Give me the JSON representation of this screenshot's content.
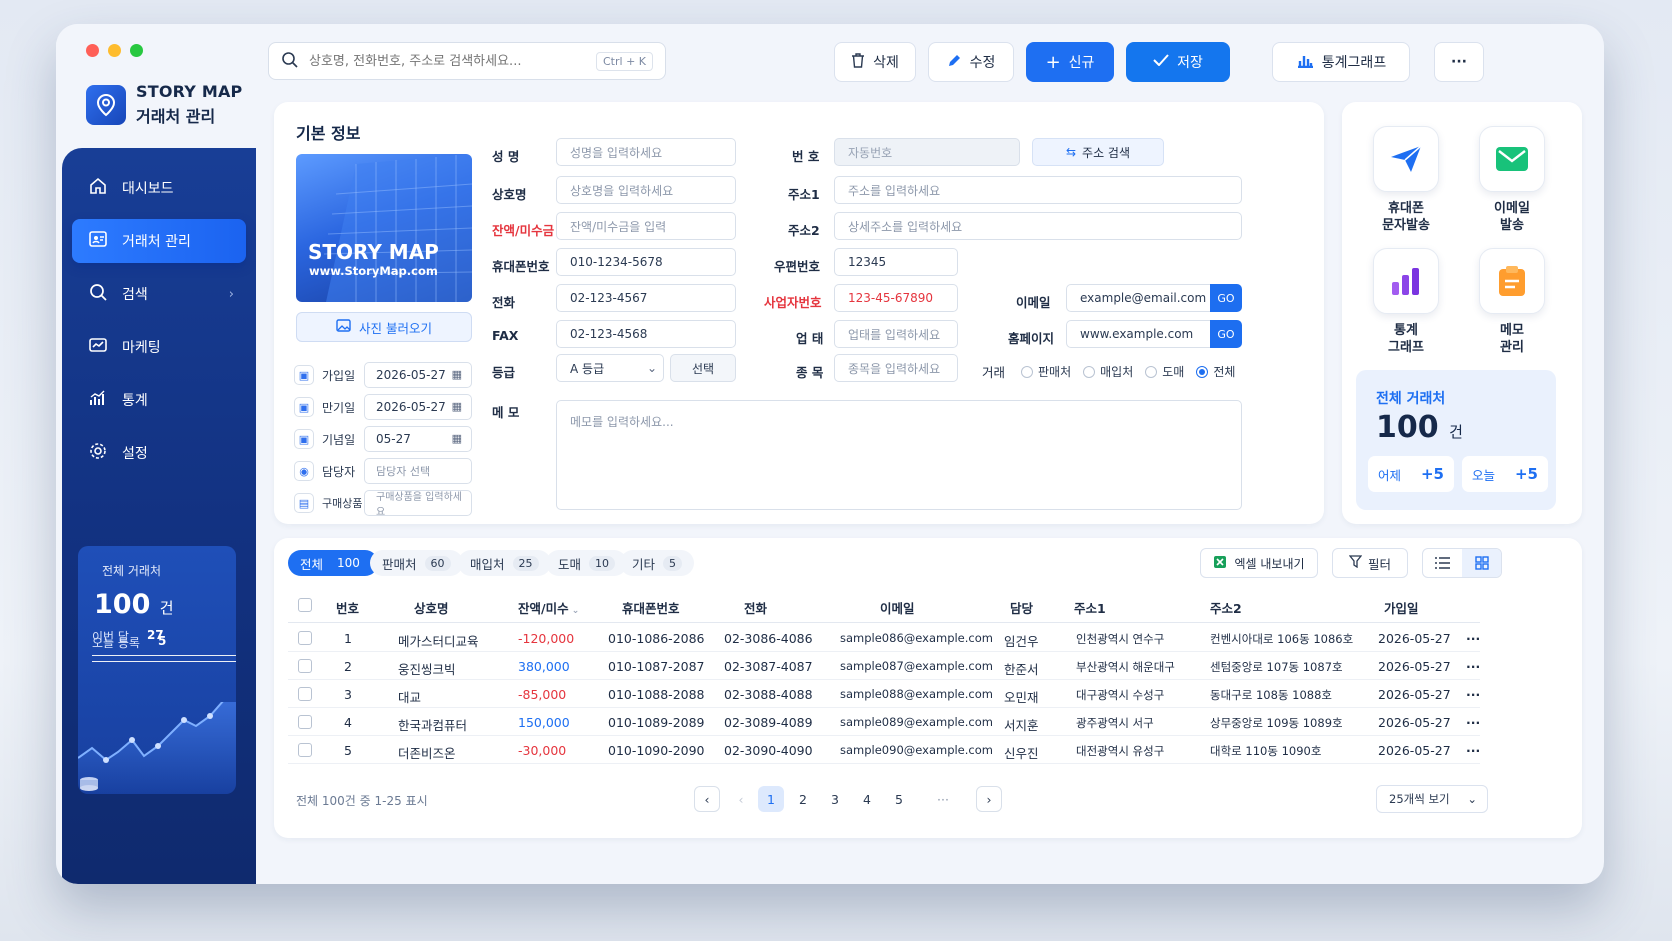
{
  "app": {
    "brand_line1": "STORY MAP",
    "brand_line2": "거래처 관리"
  },
  "nav": [
    {
      "label": "대시보드",
      "icon": "home-icon"
    },
    {
      "label": "거래처 관리",
      "icon": "client-card-icon",
      "active": true
    },
    {
      "label": "검색",
      "icon": "search-icon",
      "has_submenu": true
    },
    {
      "label": "마케팅",
      "icon": "marketing-icon"
    },
    {
      "label": "통계",
      "icon": "stats-icon"
    },
    {
      "label": "설정",
      "icon": "gear-icon"
    }
  ],
  "sidebar_summary": {
    "title": "전체 거래처",
    "count": "100",
    "unit": "건",
    "today_label": "오늘 등록",
    "today_value": "5",
    "month_label": "이번 달",
    "month_value": "27"
  },
  "toolbar": {
    "search_placeholder": "상호명, 전화번호, 주소로 검색하세요...",
    "search_shortcut": "Ctrl + K",
    "delete_label": "삭제",
    "edit_label": "수정",
    "new_label": "신규",
    "save_label": "저장",
    "chart_label": "통계그래프",
    "more_label": "···"
  },
  "form": {
    "section_title": "기본 정보",
    "photo_title": "STORY MAP",
    "photo_url": "www.StoryMap.com",
    "photo_button": "사진 불러오기",
    "dates": [
      {
        "label": "가입일",
        "value": "2026-05-27",
        "calendar": true
      },
      {
        "label": "만기일",
        "value": "2026-05-27",
        "calendar": true
      },
      {
        "label": "기념일",
        "value": "05-27",
        "calendar": true
      },
      {
        "label": "담당자",
        "value": "담당자 선택",
        "placeholder": true
      },
      {
        "label": "구매상품",
        "value": "구매상품을 입력하세요",
        "placeholder": true
      }
    ],
    "name_label": "성  명",
    "name_placeholder": "성명을 입력하세요",
    "company_label": "상호명",
    "company_placeholder": "상호명을 입력하세요",
    "balance_label": "잔액/미수금",
    "balance_placeholder": "잔액/미수금을 입력",
    "mobile_label": "휴대폰번호",
    "mobile_value": "010-1234-5678",
    "phone_label": "전화",
    "phone_value": "02-123-4567",
    "fax_label": "FAX",
    "fax_value": "02-123-4568",
    "grade_label": "등급",
    "grade_value": "A 등급",
    "grade_button": "선택",
    "memo_label": "메 모",
    "memo_placeholder": "메모를 입력하세요...",
    "no_label": "번 호",
    "no_placeholder": "자동번호",
    "addr_search_button": "주소 검색",
    "addr1_label": "주소1",
    "addr1_placeholder": "주소를 입력하세요",
    "addr2_label": "주소2",
    "addr2_placeholder": "상세주소를 입력하세요",
    "zip_label": "우편번호",
    "zip_value": "12345",
    "bizno_label": "사업자번호",
    "bizno_value": "123-45-67890",
    "biztype_label": "업 태",
    "biztype_placeholder": "업태를 입력하세요",
    "item_label": "종 목",
    "item_placeholder": "종목을 입력하세요",
    "email_label": "이메일",
    "email_value": "example@email.com",
    "email_go": "GO",
    "homepage_label": "홈페이지",
    "homepage_value": "www.example.com",
    "homepage_go": "GO",
    "trade_label": "거래",
    "trade_options": [
      {
        "label": "판매처",
        "selected": false
      },
      {
        "label": "매입처",
        "selected": false
      },
      {
        "label": "도매",
        "selected": false
      },
      {
        "label": "전체",
        "selected": true
      }
    ]
  },
  "quick_actions": [
    {
      "line1": "휴대폰",
      "line2": "문자발송",
      "icon": "send-icon"
    },
    {
      "line1": "이메일",
      "line2": "발송",
      "icon": "mail-icon"
    },
    {
      "line1": "통계",
      "line2": "그래프",
      "icon": "bar-chart-icon"
    },
    {
      "line1": "메모",
      "line2": "관리",
      "icon": "memo-icon"
    }
  ],
  "total_card": {
    "title": "전체 거래처",
    "count": "100",
    "unit": "건",
    "yesterday_label": "어제",
    "yesterday_value": "+5",
    "today_label": "오늘",
    "today_value": "+5"
  },
  "filters": {
    "tabs": [
      {
        "label": "전체",
        "count": "100",
        "active": true
      },
      {
        "label": "판매처",
        "count": "60"
      },
      {
        "label": "매입처",
        "count": "25"
      },
      {
        "label": "도매",
        "count": "10"
      },
      {
        "label": "기타",
        "count": "5"
      }
    ],
    "excel_label": "엑셀 내보내기",
    "filter_label": "필터"
  },
  "table": {
    "headers": [
      "번호",
      "상호명",
      "잔액/미수",
      "휴대폰번호",
      "전화",
      "이메일",
      "담당",
      "주소1",
      "주소2",
      "가입일"
    ],
    "rows": [
      {
        "no": "1",
        "name": "메가스터디교육",
        "balance": "-120,000",
        "mobile": "010-1086-2086",
        "phone": "02-3086-4086",
        "email": "sample086@example.com",
        "manager": "임건우",
        "addr1": "인천광역시 연수구",
        "addr2": "컨벤시아대로 106동 1086호",
        "joined": "2026-05-27"
      },
      {
        "no": "2",
        "name": "웅진씽크빅",
        "balance": "380,000",
        "mobile": "010-1087-2087",
        "phone": "02-3087-4087",
        "email": "sample087@example.com",
        "manager": "한준서",
        "addr1": "부산광역시 해운대구",
        "addr2": "센텀중앙로 107동 1087호",
        "joined": "2026-05-27"
      },
      {
        "no": "3",
        "name": "대교",
        "balance": "-85,000",
        "mobile": "010-1088-2088",
        "phone": "02-3088-4088",
        "email": "sample088@example.com",
        "manager": "오민재",
        "addr1": "대구광역시 수성구",
        "addr2": "동대구로 108동 1088호",
        "joined": "2026-05-27"
      },
      {
        "no": "4",
        "name": "한국과컴퓨터",
        "balance": "150,000",
        "mobile": "010-1089-2089",
        "phone": "02-3089-4089",
        "email": "sample089@example.com",
        "manager": "서지훈",
        "addr1": "광주광역시 서구",
        "addr2": "상무중앙로 109동 1089호",
        "joined": "2026-05-27"
      },
      {
        "no": "5",
        "name": "더존비즈온",
        "balance": "-30,000",
        "mobile": "010-1090-2090",
        "phone": "02-3090-4090",
        "email": "sample090@example.com",
        "manager": "신우진",
        "addr1": "대전광역시 유성구",
        "addr2": "대학로 110동 1090호",
        "joined": "2026-05-27"
      }
    ],
    "row_more": "···"
  },
  "pagination": {
    "summary": "전체 100건 중 1-25 표시",
    "pages": [
      "1",
      "2",
      "3",
      "4",
      "5"
    ],
    "current": "1",
    "ellipsis": "···",
    "page_size": "25개씩 보기"
  }
}
